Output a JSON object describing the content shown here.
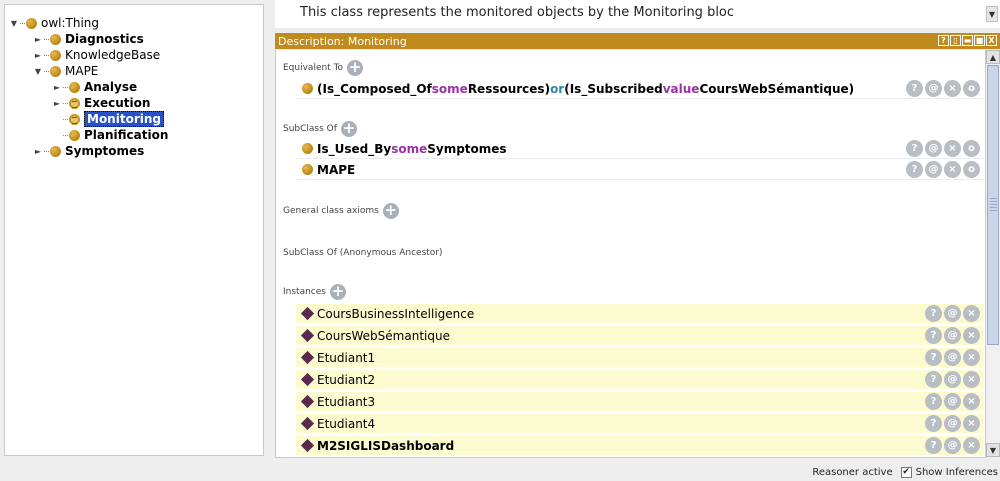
{
  "top_description": "This class represents the monitored objects by the Monitoring bloc",
  "hierarchy": {
    "root": "owl:Thing",
    "items": [
      {
        "label": "Diagnostics"
      },
      {
        "label": "KnowledgeBase"
      },
      {
        "label": "MAPE"
      },
      {
        "label": "Analyse"
      },
      {
        "label": "Execution"
      },
      {
        "label": "Monitoring"
      },
      {
        "label": "Planification"
      },
      {
        "label": "Symptomes"
      }
    ]
  },
  "panel": {
    "header": "Description: Monitoring",
    "header_buttons": [
      "?",
      "▯",
      "▬",
      "■",
      "X"
    ]
  },
  "sections": {
    "equivalent_to": "Equivalent To",
    "subclass_of": "SubClass Of",
    "general_axioms": "General class axioms",
    "anon_ancestor": "SubClass Of (Anonymous Ancestor)",
    "instances": "Instances"
  },
  "equivalent": {
    "p1": "(Is_Composed_Of ",
    "k1": "some",
    "p2": " Ressources) ",
    "k2": "or",
    "p3": " (Is_Subscribed ",
    "k3": "value",
    "p4": " CoursWebSémantique)"
  },
  "subclass": {
    "row1_a": "Is_Used_By ",
    "row1_kw": "some",
    "row1_b": " Symptomes",
    "row2": "MAPE"
  },
  "instances": [
    "CoursBusinessIntelligence",
    "CoursWebSémantique",
    "Etudiant1",
    "Etudiant2",
    "Etudiant3",
    "Etudiant4",
    "M2SIGLISDashboard"
  ],
  "row_buttons": {
    "help": "?",
    "annotate": "@",
    "delete": "×",
    "edit": "o"
  },
  "status": {
    "reasoner": "Reasoner active",
    "show_inferences": "Show Inferences",
    "show_inferences_checked": true
  },
  "colors": {
    "header_bg": "#c18a1d",
    "class_icon": "#d9a033",
    "individual_icon": "#5b2a4a",
    "keyword": "#9b30a8",
    "value_keyword": "#2a8aa5",
    "selection": "#2552c7",
    "inferred_row": "#fbfbcf"
  }
}
